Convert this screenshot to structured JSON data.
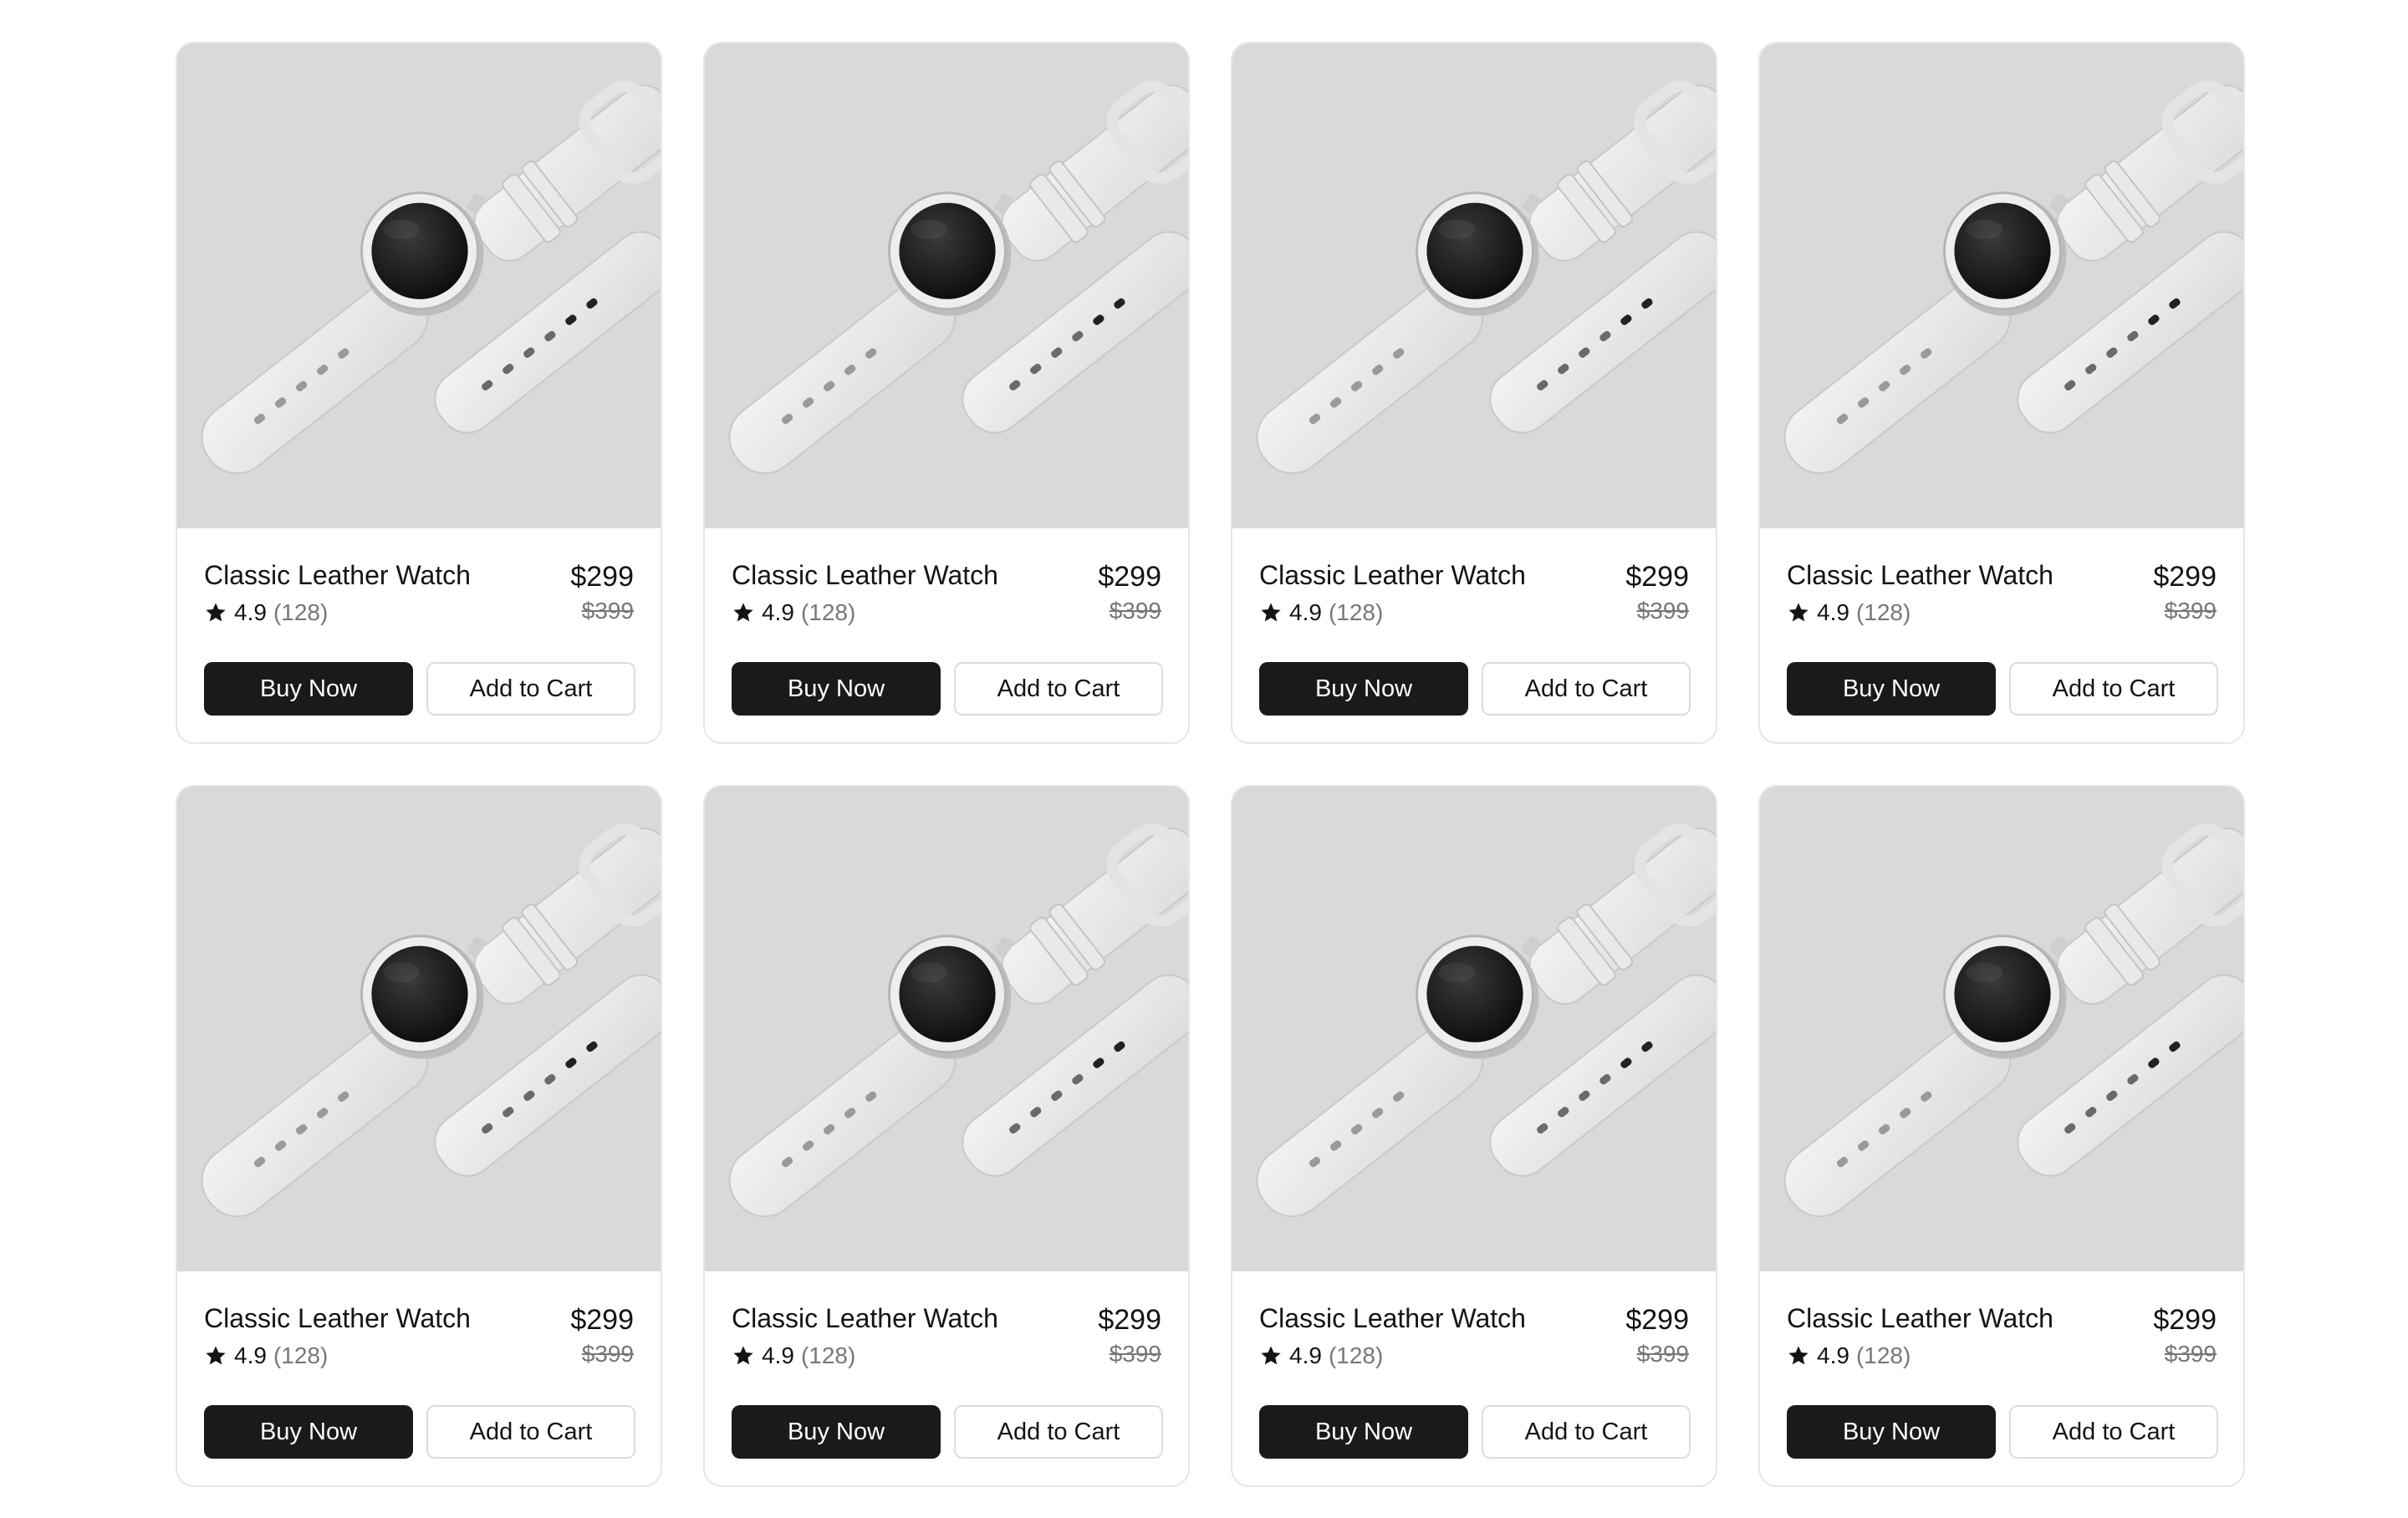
{
  "colors": {
    "image_bg": "#d9d9d9",
    "buy_button_bg": "#1a1a1a",
    "card_border": "#e6e6e6",
    "muted_text": "#777777"
  },
  "products": [
    {
      "name": "Classic Leather Watch",
      "price": "$299",
      "old_price": "$399",
      "rating": "4.9",
      "reviews": "(128)",
      "buy_label": "Buy Now",
      "cart_label": "Add to Cart",
      "image_icon": "smartwatch-photo"
    },
    {
      "name": "Classic Leather Watch",
      "price": "$299",
      "old_price": "$399",
      "rating": "4.9",
      "reviews": "(128)",
      "buy_label": "Buy Now",
      "cart_label": "Add to Cart",
      "image_icon": "smartwatch-photo"
    },
    {
      "name": "Classic Leather Watch",
      "price": "$299",
      "old_price": "$399",
      "rating": "4.9",
      "reviews": "(128)",
      "buy_label": "Buy Now",
      "cart_label": "Add to Cart",
      "image_icon": "smartwatch-photo"
    },
    {
      "name": "Classic Leather Watch",
      "price": "$299",
      "old_price": "$399",
      "rating": "4.9",
      "reviews": "(128)",
      "buy_label": "Buy Now",
      "cart_label": "Add to Cart",
      "image_icon": "smartwatch-photo"
    },
    {
      "name": "Classic Leather Watch",
      "price": "$299",
      "old_price": "$399",
      "rating": "4.9",
      "reviews": "(128)",
      "buy_label": "Buy Now",
      "cart_label": "Add to Cart",
      "image_icon": "smartwatch-photo"
    },
    {
      "name": "Classic Leather Watch",
      "price": "$299",
      "old_price": "$399",
      "rating": "4.9",
      "reviews": "(128)",
      "buy_label": "Buy Now",
      "cart_label": "Add to Cart",
      "image_icon": "smartwatch-photo"
    },
    {
      "name": "Classic Leather Watch",
      "price": "$299",
      "old_price": "$399",
      "rating": "4.9",
      "reviews": "(128)",
      "buy_label": "Buy Now",
      "cart_label": "Add to Cart",
      "image_icon": "smartwatch-photo"
    },
    {
      "name": "Classic Leather Watch",
      "price": "$299",
      "old_price": "$399",
      "rating": "4.9",
      "reviews": "(128)",
      "buy_label": "Buy Now",
      "cart_label": "Add to Cart",
      "image_icon": "smartwatch-photo"
    }
  ]
}
